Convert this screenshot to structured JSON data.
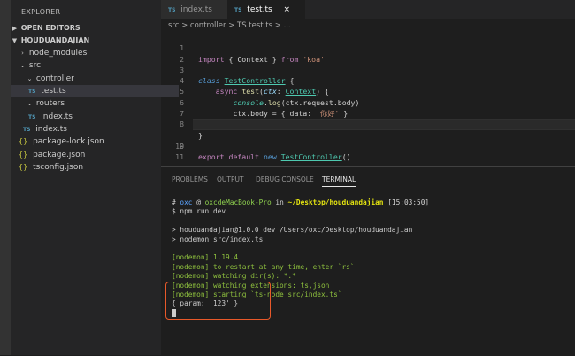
{
  "sidebar": {
    "title": "EXPLORER",
    "open_editors": "OPEN EDITORS",
    "project": "HOUDUANDAJIAN",
    "items": [
      {
        "label": "node_modules"
      },
      {
        "label": "src"
      },
      {
        "label": "controller"
      },
      {
        "label": "test.ts",
        "icon": "TS"
      },
      {
        "label": "routers"
      },
      {
        "label": "index.ts",
        "icon": "TS"
      },
      {
        "label": "index.ts",
        "icon": "TS"
      },
      {
        "label": "package-lock.json",
        "icon": "{}"
      },
      {
        "label": "package.json",
        "icon": "{}"
      },
      {
        "label": "tsconfig.json",
        "icon": "{}"
      }
    ]
  },
  "tabs": [
    {
      "icon": "TS",
      "label": "index.ts"
    },
    {
      "icon": "TS",
      "label": "test.ts",
      "close": "×"
    }
  ],
  "breadcrumb": "src > controller > TS test.ts > ...",
  "code": {
    "line_numbers": [
      "1",
      "2",
      "3",
      "4",
      "5",
      "6",
      "7",
      "8",
      "9",
      "10",
      "11",
      "12"
    ],
    "l1": {
      "a": "import",
      "b": " { Context } ",
      "c": "from",
      "d": " 'koa'"
    },
    "l3": {
      "a": "class",
      "b": "TestController",
      "c": " {"
    },
    "l4": {
      "a": "async",
      "b": "test",
      "c": "(",
      "d": "ctx",
      "e": ": ",
      "f": "Context",
      "g": ") {"
    },
    "l5": {
      "a": "console",
      "b": ".",
      "c": "log",
      "d": "(ctx.request.body)"
    },
    "l6": {
      "a": "ctx.body = { data: ",
      "b": "'你好'",
      "c": " }"
    },
    "l7": "}",
    "l8": "}",
    "l10": {
      "a": "export",
      "b": "default",
      "c": "new",
      "d": "TestController",
      "e": "()"
    }
  },
  "panel": {
    "tabs": [
      "PROBLEMS",
      "OUTPUT",
      "DEBUG CONSOLE",
      "TERMINAL"
    ],
    "active_tab": "TERMINAL"
  },
  "terminal": {
    "prompt_hash": "#",
    "user": "oxc",
    "at": "@",
    "host": "oxcdeMacBook-Pro",
    "in": "in",
    "path": "~/Desktop/houduandajian",
    "time": "[15:03:50]",
    "cmd": "$ npm run dev",
    "npm1": "> houduandajian@1.0.0 dev /Users/oxc/Desktop/houduandajian",
    "npm2": "> nodemon src/index.ts",
    "nm1": "[nodemon] 1.19.4",
    "nm2": "[nodemon] to restart at any time, enter `rs`",
    "nm3": "[nodemon] watching dir(s): *.*",
    "nm4": "[nodemon] watching extensions: ts,json",
    "nm5": "[nodemon] starting `ts-node src/index.ts`",
    "output": "{ param: '123' }"
  },
  "colors": {
    "accent_highlight_box": "#e8592a",
    "ts_icon": "#519aba",
    "json_icon": "#cbcb41"
  }
}
